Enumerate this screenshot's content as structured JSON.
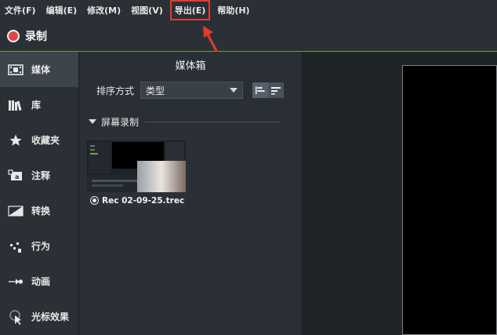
{
  "menubar": {
    "items": [
      {
        "label": "文件(F)"
      },
      {
        "label": "编辑(E)"
      },
      {
        "label": "修改(M)"
      },
      {
        "label": "视图(V)"
      },
      {
        "label": "导出(E)",
        "highlighted": true
      },
      {
        "label": "帮助(H)"
      }
    ]
  },
  "record": {
    "label": "录制"
  },
  "sidebar": {
    "items": [
      {
        "label": "媒体",
        "icon": "film-icon",
        "active": true
      },
      {
        "label": "库",
        "icon": "library-icon"
      },
      {
        "label": "收藏夹",
        "icon": "star-icon"
      },
      {
        "label": "注释",
        "icon": "annotation-icon"
      },
      {
        "label": "转换",
        "icon": "transition-icon"
      },
      {
        "label": "行为",
        "icon": "behavior-icon"
      },
      {
        "label": "动画",
        "icon": "animation-icon"
      },
      {
        "label": "光标效果",
        "icon": "cursor-effect-icon"
      }
    ]
  },
  "media_bin": {
    "title": "媒体箱",
    "sort_label": "排序方式",
    "sort_value": "类型",
    "group_label": "屏幕录制",
    "clips": [
      {
        "name": "Rec 02-09-25.trec"
      }
    ]
  },
  "colors": {
    "highlight": "#e23b2e",
    "record": "#e04646",
    "accent_line": "#6f9c3a"
  }
}
